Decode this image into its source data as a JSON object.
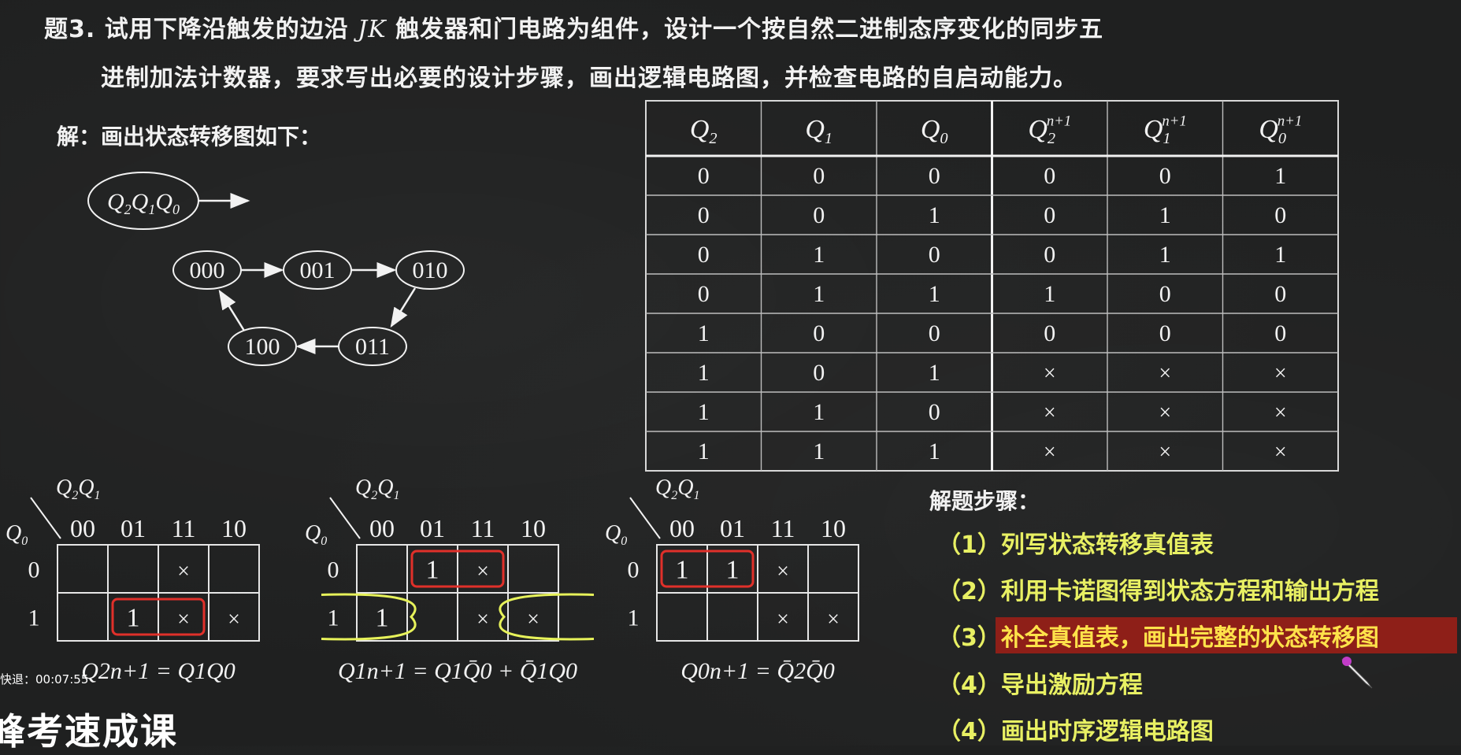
{
  "question": {
    "line1_prefix": "题3. 试用下降沿触发的边沿",
    "line1_jk": "JK",
    "line1_suffix": "触发器和门电路为组件，设计一个按自然二进制态序变化的同步五",
    "line2": "进制加法计数器，要求写出必要的设计步骤，画出逻辑电路图，并检查电路的自启动能力。"
  },
  "solution_label": "解：画出状态转移图如下：",
  "state_diagram": {
    "legend": "Q2Q1Q0",
    "states": [
      "000",
      "001",
      "010",
      "011",
      "100"
    ]
  },
  "truth_table": {
    "headers": [
      "Q2",
      "Q1",
      "Q0",
      "Q2n+1",
      "Q1n+1",
      "Q0n+1"
    ],
    "rows": [
      [
        "0",
        "0",
        "0",
        "0",
        "0",
        "1"
      ],
      [
        "0",
        "0",
        "1",
        "0",
        "1",
        "0"
      ],
      [
        "0",
        "1",
        "0",
        "0",
        "1",
        "1"
      ],
      [
        "0",
        "1",
        "1",
        "1",
        "0",
        "0"
      ],
      [
        "1",
        "0",
        "0",
        "0",
        "0",
        "0"
      ],
      [
        "1",
        "0",
        "1",
        "×",
        "×",
        "×"
      ],
      [
        "1",
        "1",
        "0",
        "×",
        "×",
        "×"
      ],
      [
        "1",
        "1",
        "1",
        "×",
        "×",
        "×"
      ]
    ]
  },
  "kmaps": [
    {
      "col_labels": [
        "00",
        "01",
        "11",
        "10"
      ],
      "row_labels": [
        "0",
        "1"
      ],
      "cells": [
        [
          "",
          "",
          "×",
          ""
        ],
        [
          "",
          "1",
          "×",
          "×"
        ]
      ],
      "equation": "Q2n+1 = Q1Q0"
    },
    {
      "col_labels": [
        "00",
        "01",
        "11",
        "10"
      ],
      "row_labels": [
        "0",
        "1"
      ],
      "cells": [
        [
          "",
          "1",
          "×",
          ""
        ],
        [
          "1",
          "",
          "×",
          "×"
        ]
      ],
      "equation": "Q1n+1 = Q1Q̄0 + Q̄1Q0"
    },
    {
      "col_labels": [
        "00",
        "01",
        "11",
        "10"
      ],
      "row_labels": [
        "0",
        "1"
      ],
      "cells": [
        [
          "1",
          "1",
          "×",
          ""
        ],
        [
          "",
          "",
          "×",
          "×"
        ]
      ],
      "equation": "Q0n+1 = Q̄2Q̄0"
    }
  ],
  "kmap_axis": {
    "top": "Q2Q1",
    "side": "Q0"
  },
  "steps": {
    "title": "解题步骤：",
    "items": [
      "（1）列写状态转移真值表",
      "（2）利用卡诺图得到状态方程和输出方程",
      "（3）补全真值表，画出完整的状态转移图",
      "（4）导出激励方程",
      "（4）画出时序逻辑电路图"
    ]
  },
  "timer": "快退：00:07:55",
  "logo_text": "峰考速成课",
  "colors": {
    "board": "#1f2020",
    "chalk": "#f2f2f2",
    "step_text": "#e8f063",
    "highlight_bg": "#8e1f18",
    "highlight_text": "#ffe24a",
    "red_loop": "#e0302a",
    "yellow_loop": "#e7f25a"
  }
}
